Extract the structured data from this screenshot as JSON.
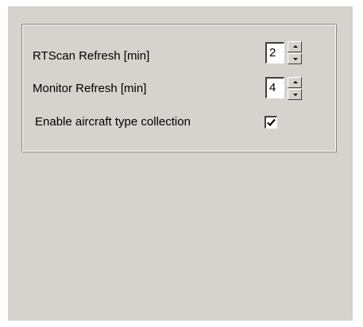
{
  "settings": {
    "rtscan_refresh": {
      "label": "RTScan Refresh [min]",
      "value": "2"
    },
    "monitor_refresh": {
      "label": "Monitor Refresh [min]",
      "value": "4"
    },
    "aircraft_type_collection": {
      "label": "Enable aircraft type collection",
      "checked": true
    }
  },
  "icons": {
    "spin_up": "up-arrow-icon",
    "spin_down": "down-arrow-icon",
    "check": "checkmark-icon"
  },
  "colors": {
    "dialog_background": "#d6d3ce",
    "field_background": "#ffffff",
    "text": "#000000"
  }
}
